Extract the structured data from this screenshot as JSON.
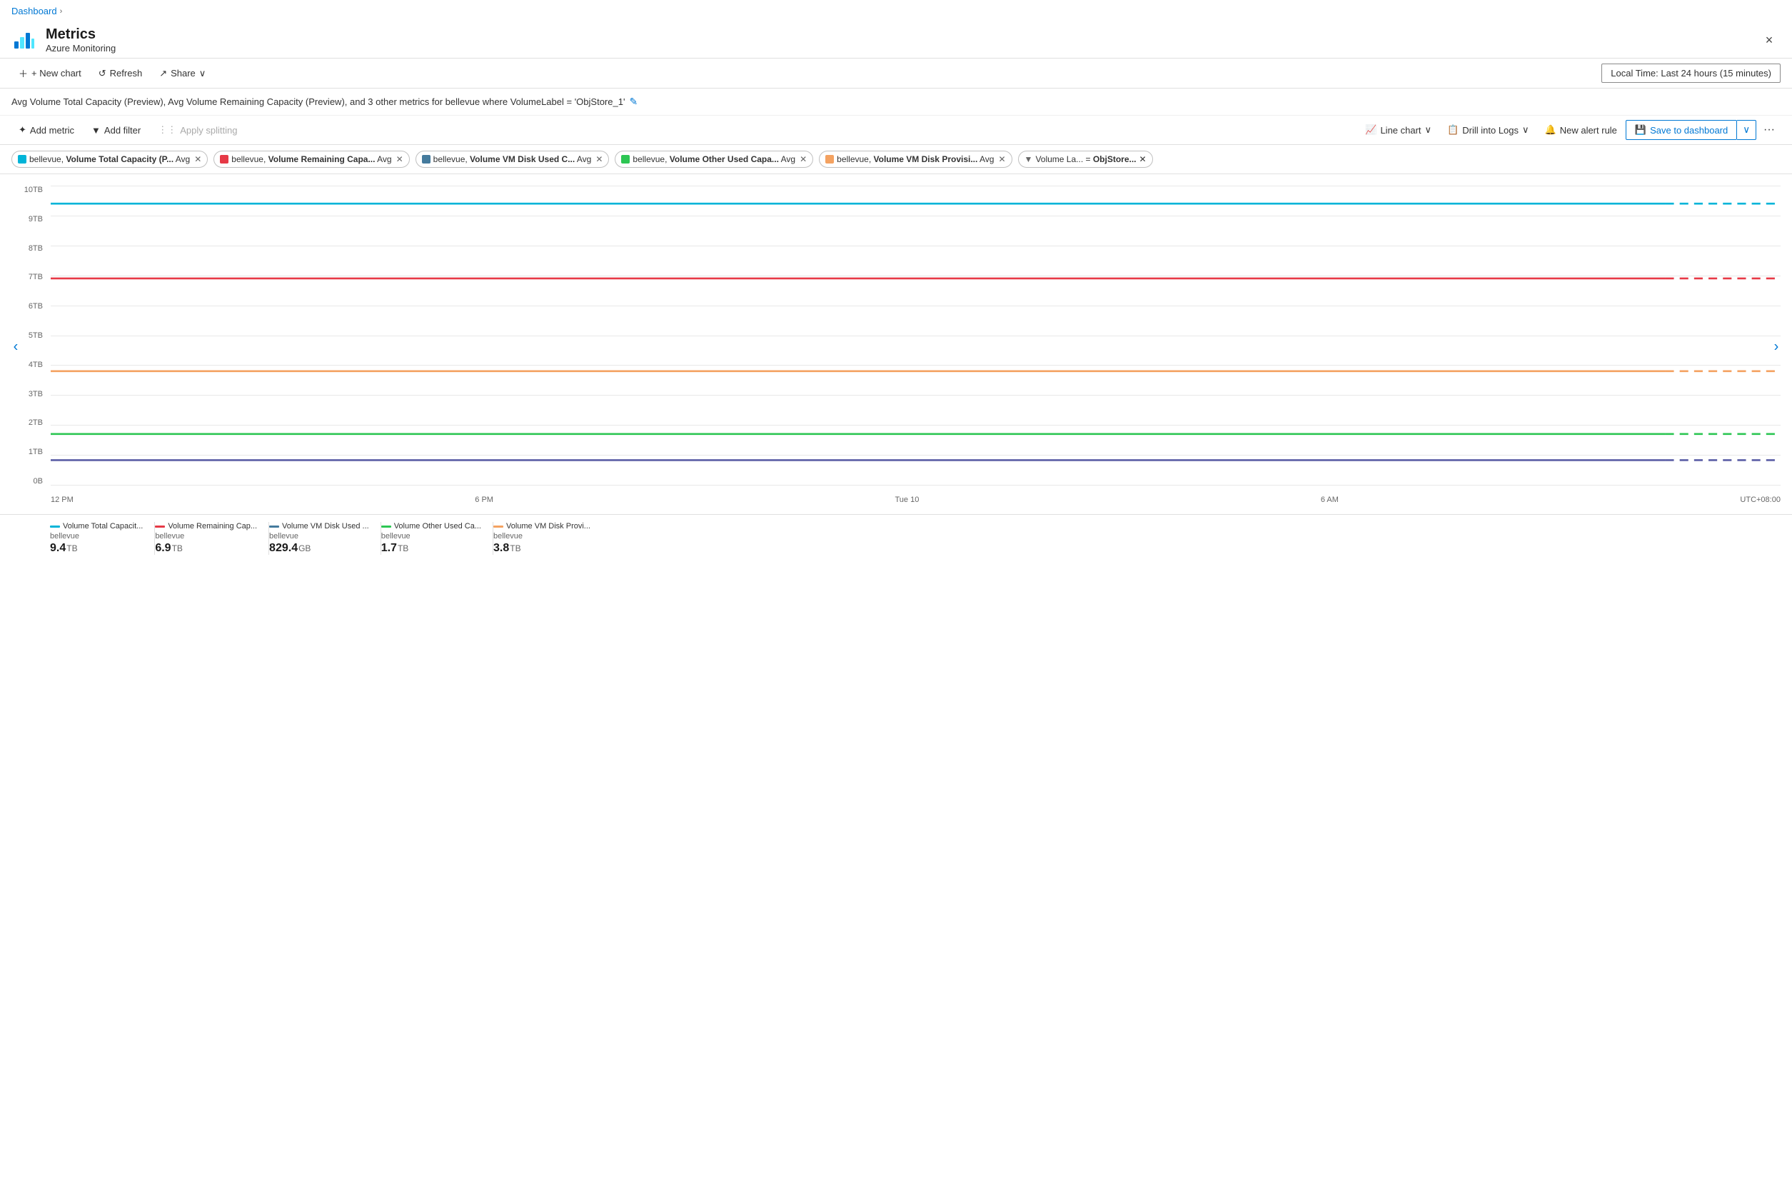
{
  "breadcrumb": {
    "items": [
      "Dashboard"
    ],
    "chevron": "›"
  },
  "header": {
    "title": "Metrics",
    "subtitle": "Azure Monitoring",
    "close_label": "×"
  },
  "top_toolbar": {
    "new_chart_label": "+ New chart",
    "refresh_label": "Refresh",
    "share_label": "Share",
    "time_range_label": "Local Time: Last 24 hours (15 minutes)"
  },
  "chart_title": "Avg Volume Total Capacity (Preview), Avg Volume Remaining Capacity (Preview), and 3 other metrics for bellevue where VolumeLabel = 'ObjStore_1'",
  "metrics_toolbar": {
    "add_metric_label": "Add metric",
    "add_filter_label": "Add filter",
    "apply_splitting_label": "Apply splitting",
    "line_chart_label": "Line chart",
    "drill_into_logs_label": "Drill into Logs",
    "new_alert_rule_label": "New alert rule",
    "save_to_dashboard_label": "Save to dashboard",
    "more_label": "···"
  },
  "tags": [
    {
      "id": "tag1",
      "color": "#00b4d8",
      "text": "bellevue, ",
      "bold": "Volume Total Capacity (P...",
      "suffix": " Avg",
      "close": true
    },
    {
      "id": "tag2",
      "color": "#e63946",
      "text": "bellevue, ",
      "bold": "Volume Remaining Capa...",
      "suffix": " Avg",
      "close": true
    },
    {
      "id": "tag3",
      "color": "#457b9d",
      "text": "bellevue, ",
      "bold": "Volume VM Disk Used C...",
      "suffix": " Avg",
      "close": true
    },
    {
      "id": "tag4",
      "color": "#2dc653",
      "text": "bellevue, ",
      "bold": "Volume Other Used Capa...",
      "suffix": " Avg",
      "close": true
    },
    {
      "id": "tag5",
      "color": "#f4a261",
      "text": "bellevue, ",
      "bold": "Volume VM Disk Provisi...",
      "suffix": " Avg",
      "close": true
    }
  ],
  "filter_tag": {
    "label": "Volume La... = ObjStore...",
    "close": true
  },
  "chart": {
    "y_labels": [
      "10TB",
      "9TB",
      "8TB",
      "7TB",
      "6TB",
      "5TB",
      "4TB",
      "3TB",
      "2TB",
      "1TB",
      "0B"
    ],
    "x_labels": [
      "12 PM",
      "6 PM",
      "Tue 10",
      "6 AM",
      "UTC+08:00"
    ],
    "lines": [
      {
        "id": "line1",
        "color": "#00b4d8",
        "y_pct": 89,
        "dashed_end": true
      },
      {
        "id": "line2",
        "color": "#e63946",
        "y_pct": 69,
        "dashed_end": true
      },
      {
        "id": "line3",
        "color": "#f4a261",
        "y_pct": 38,
        "dashed_end": true
      },
      {
        "id": "line4",
        "color": "#2dc653",
        "y_pct": 15,
        "dashed_end": true
      },
      {
        "id": "line5",
        "color": "#5b5ea6",
        "y_pct": 8,
        "dashed_end": true
      }
    ]
  },
  "legend": [
    {
      "id": "leg1",
      "color": "#00b4d8",
      "label": "Volume Total Capacit...",
      "sub": "bellevue",
      "value": "9.4",
      "unit": "TB"
    },
    {
      "id": "leg2",
      "color": "#e63946",
      "label": "Volume Remaining Cap...",
      "sub": "bellevue",
      "value": "6.9",
      "unit": "TB"
    },
    {
      "id": "leg3",
      "color": "#457b9d",
      "label": "Volume VM Disk Used ...",
      "sub": "bellevue",
      "value": "829.4",
      "unit": "GB"
    },
    {
      "id": "leg4",
      "color": "#2dc653",
      "label": "Volume Other Used Ca...",
      "sub": "bellevue",
      "value": "1.7",
      "unit": "TB"
    },
    {
      "id": "leg5",
      "color": "#f4a261",
      "label": "Volume VM Disk Provi...",
      "sub": "bellevue",
      "value": "3.8",
      "unit": "TB"
    }
  ]
}
